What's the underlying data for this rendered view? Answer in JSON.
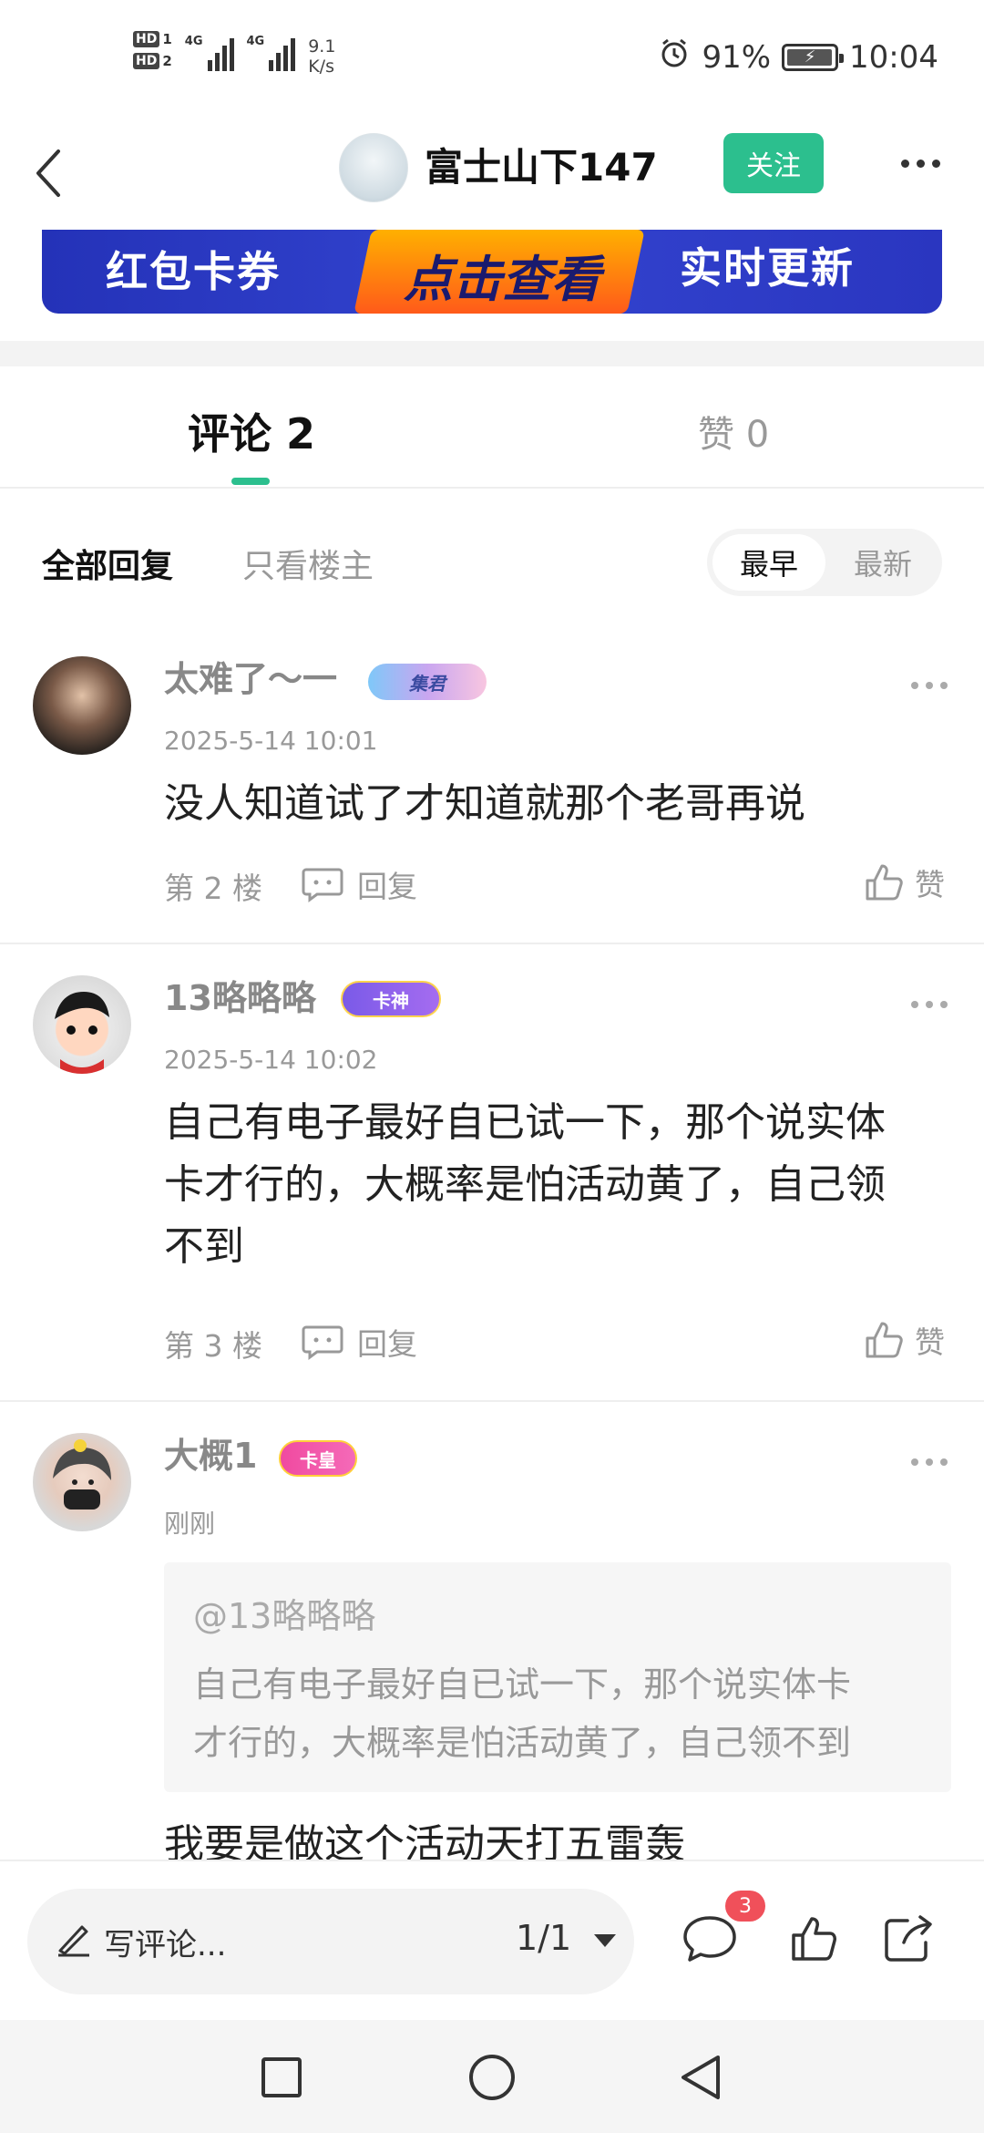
{
  "status_bar": {
    "hd1": "HD",
    "hd1_sim": "1",
    "hd2": "HD",
    "hd2_sim": "2",
    "signal1": "4G",
    "signal2": "4G",
    "net_speed_value": "9.1",
    "net_speed_unit": "K/s",
    "battery": "91%",
    "time": "10:04"
  },
  "header": {
    "title": "富士山下147",
    "follow_label": "关注"
  },
  "banner": {
    "left_text": "红包卡券",
    "center_text": "点击查看",
    "right_text": "实时更新"
  },
  "tabs": {
    "comments": "评论 2",
    "likes": "赞 0"
  },
  "filters": {
    "all": "全部回复",
    "owner_only": "只看楼主",
    "sort_earliest": "最早",
    "sort_newest": "最新"
  },
  "comments": [
    {
      "username": "太难了～一",
      "badge": "集君",
      "time": "2025-5-14 10:01",
      "text": "没人知道试了才知道就那个老哥再说",
      "floor": "第 2 楼",
      "reply_label": "回复",
      "like_label": "赞"
    },
    {
      "username": "13略略略",
      "badge": "卡神",
      "time": "2025-5-14 10:02",
      "text_lines": [
        "自己有电子最好自已试一下，那个说实体",
        "卡才行的，大概率是怕活动黄了，自己领",
        "不到"
      ],
      "floor": "第 3 楼",
      "reply_label": "回复",
      "like_label": "赞"
    },
    {
      "username": "大概1",
      "badge": "卡皇",
      "time": "刚刚",
      "quote_name": "@13略略略",
      "quote_lines": [
        "自己有电子最好自已试一下，那个说实体卡",
        "才行的，大概率是怕活动黄了，自己领不到"
      ],
      "text": "我要是做这个活动天打五雷轰"
    }
  ],
  "bottom_bar": {
    "write_placeholder": "写评论...",
    "page_indicator": "1/1",
    "comment_count": "3"
  },
  "colors": {
    "accent": "#2cbf8e",
    "badge_red": "#f0505a",
    "banner_blue": "#2a36c0"
  },
  "icons": [
    "back-arrow-icon",
    "more-dots-icon",
    "comment-bubble-icon",
    "thumbs-up-icon",
    "pen-icon",
    "share-icon",
    "nav-square-icon",
    "nav-circle-icon",
    "nav-triangle-icon"
  ]
}
